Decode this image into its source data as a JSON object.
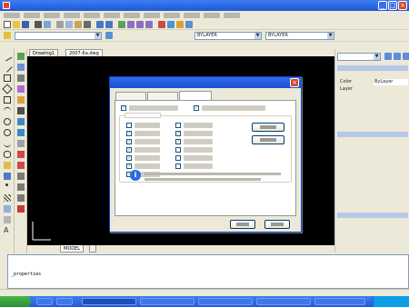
{
  "window": {
    "title": "",
    "controls": [
      "minimize",
      "maximize",
      "close"
    ]
  },
  "menu": {
    "items": [
      "",
      "",
      "",
      "",
      "",
      "",
      "",
      "",
      "",
      "",
      "",
      ""
    ]
  },
  "layer_toolbar": {
    "layer_value": "",
    "color_value": "BYLAYER",
    "linetype_value": "BYLAYER"
  },
  "drawing_tabs": [
    "Drawing1",
    "2007-6a.dwg"
  ],
  "layout_tabs": {
    "model": "MODEL",
    "layout1": ""
  },
  "properties_panel": {
    "selection": "",
    "rows": [
      {
        "key": "",
        "value": ""
      },
      {
        "key": "Color",
        "value": "ByLayer"
      },
      {
        "key": "Layer",
        "value": ""
      },
      {
        "key": "",
        "value": ""
      },
      {
        "key": "",
        "value": ""
      },
      {
        "key": "",
        "value": ""
      },
      {
        "key": "",
        "value": ""
      },
      {
        "key": "",
        "value": ""
      },
      {
        "key": "",
        "value": ""
      },
      {
        "key": "",
        "value": ""
      },
      {
        "key": "",
        "value": ""
      },
      {
        "key": "",
        "value": ""
      },
      {
        "key": "",
        "value": ""
      },
      {
        "key": "",
        "value": ""
      },
      {
        "key": "",
        "value": ""
      },
      {
        "key": "",
        "value": ""
      },
      {
        "key": "",
        "value": ""
      },
      {
        "key": "",
        "value": ""
      },
      {
        "key": "",
        "value": ""
      },
      {
        "key": "",
        "value": ""
      },
      {
        "key": "",
        "value": ""
      }
    ]
  },
  "dialog": {
    "title": "",
    "tabs": [
      "",
      "",
      ""
    ],
    "options_left": [
      "",
      "",
      "",
      "",
      "",
      "",
      "",
      ""
    ],
    "options_right": [
      "",
      "",
      "",
      "",
      "",
      "",
      ""
    ],
    "buttons": {
      "select_all": "",
      "clear_all": "",
      "ok": "",
      "cancel": ""
    }
  },
  "command": {
    "lines": [
      "",
      "",
      "_properties",
      ""
    ]
  },
  "status": {
    "coords": "",
    "toggles": ""
  },
  "colors": {
    "titlebar": "#1f56d6",
    "canvas": "#000000",
    "dialog_titlebar": "#1a4fd0",
    "taskbar": "#2459d8"
  }
}
